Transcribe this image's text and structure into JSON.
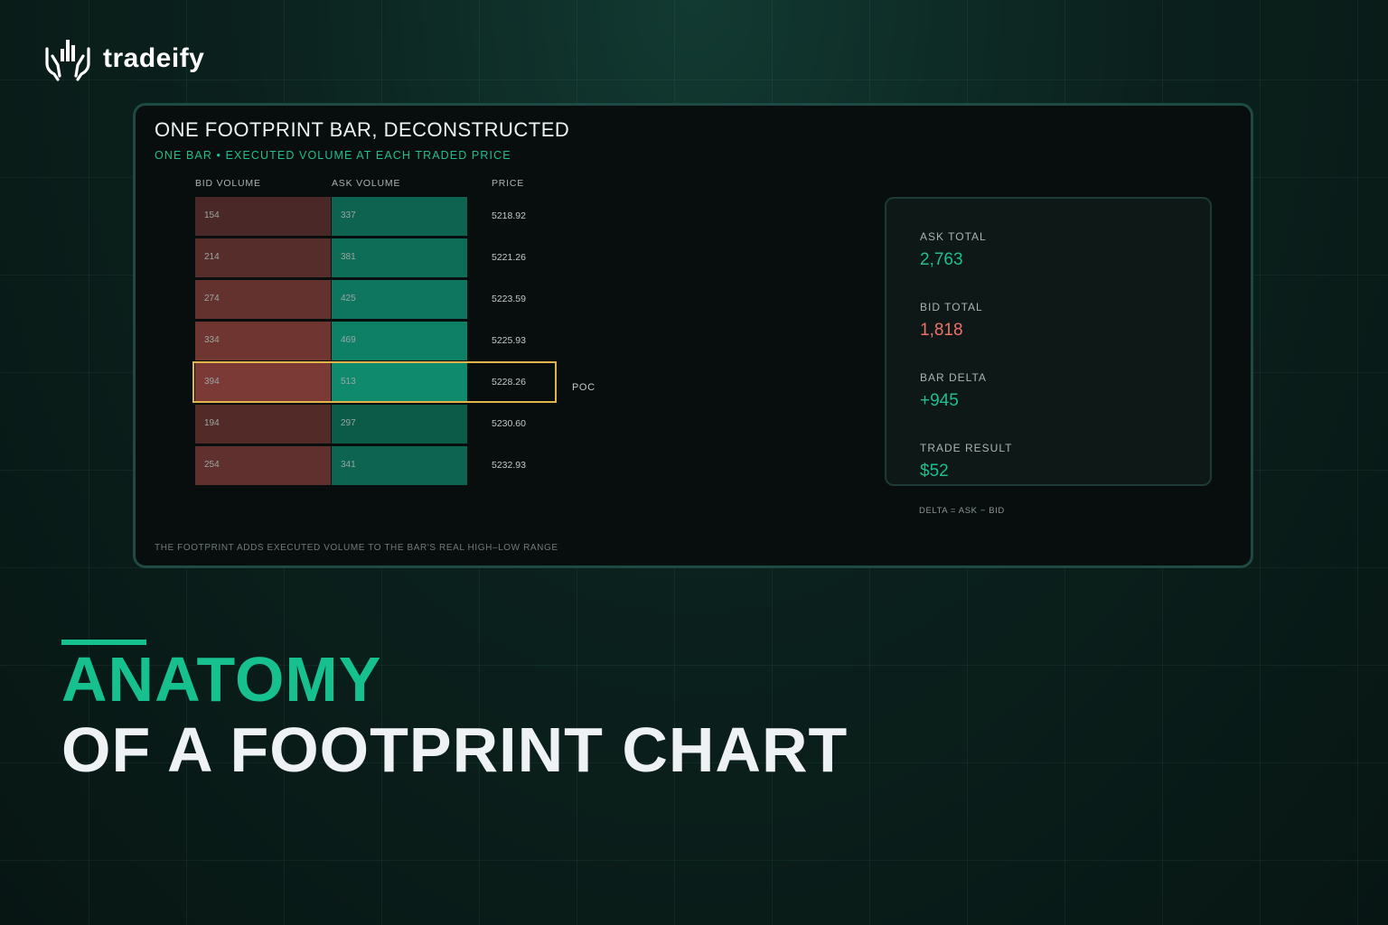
{
  "brand": {
    "name": "tradeify",
    "icon": "hands-chart-icon"
  },
  "panel": {
    "title": "ONE FOOTPRINT BAR, DECONSTRUCTED",
    "subtitle": "ONE BAR • EXECUTED VOLUME AT EACH TRADED PRICE",
    "footer_note": "THE FOOTPRINT ADDS EXECUTED VOLUME TO THE BAR'S REAL HIGH–LOW RANGE",
    "poc_label": "POC"
  },
  "chart_data": {
    "type": "table",
    "columns": [
      "BID VOLUME",
      "ASK VOLUME",
      "PRICE"
    ],
    "rows": [
      {
        "bid": "154",
        "ask": "337",
        "price": "5218.92"
      },
      {
        "bid": "214",
        "ask": "381",
        "price": "5221.26"
      },
      {
        "bid": "274",
        "ask": "425",
        "price": "5223.59"
      },
      {
        "bid": "334",
        "ask": "469",
        "price": "5225.93"
      },
      {
        "bid": "394",
        "ask": "513",
        "price": "5228.26"
      },
      {
        "bid": "194",
        "ask": "297",
        "price": "5230.60"
      },
      {
        "bid": "254",
        "ask": "341",
        "price": "5232.93"
      }
    ],
    "poc_price": "5228.26",
    "colors": {
      "bid": "#7b3a35",
      "ask": "#0f8a6d",
      "poc": "#e2b44d"
    }
  },
  "stats": [
    {
      "label": "ASK TOTAL",
      "value": "2,763",
      "color": "#1fbf8f"
    },
    {
      "label": "BID TOTAL",
      "value": "1,818",
      "color": "#f0716a"
    },
    {
      "label": "BAR DELTA",
      "value": "+945",
      "color": "#1fbf8f"
    },
    {
      "label": "TRADE RESULT",
      "value": "$52",
      "color": "#1fbf8f"
    }
  ],
  "delta_note": "DELTA = ASK − BID",
  "headline": {
    "line1": "ANATOMY",
    "line2": "OF A FOOTPRINT CHART"
  }
}
